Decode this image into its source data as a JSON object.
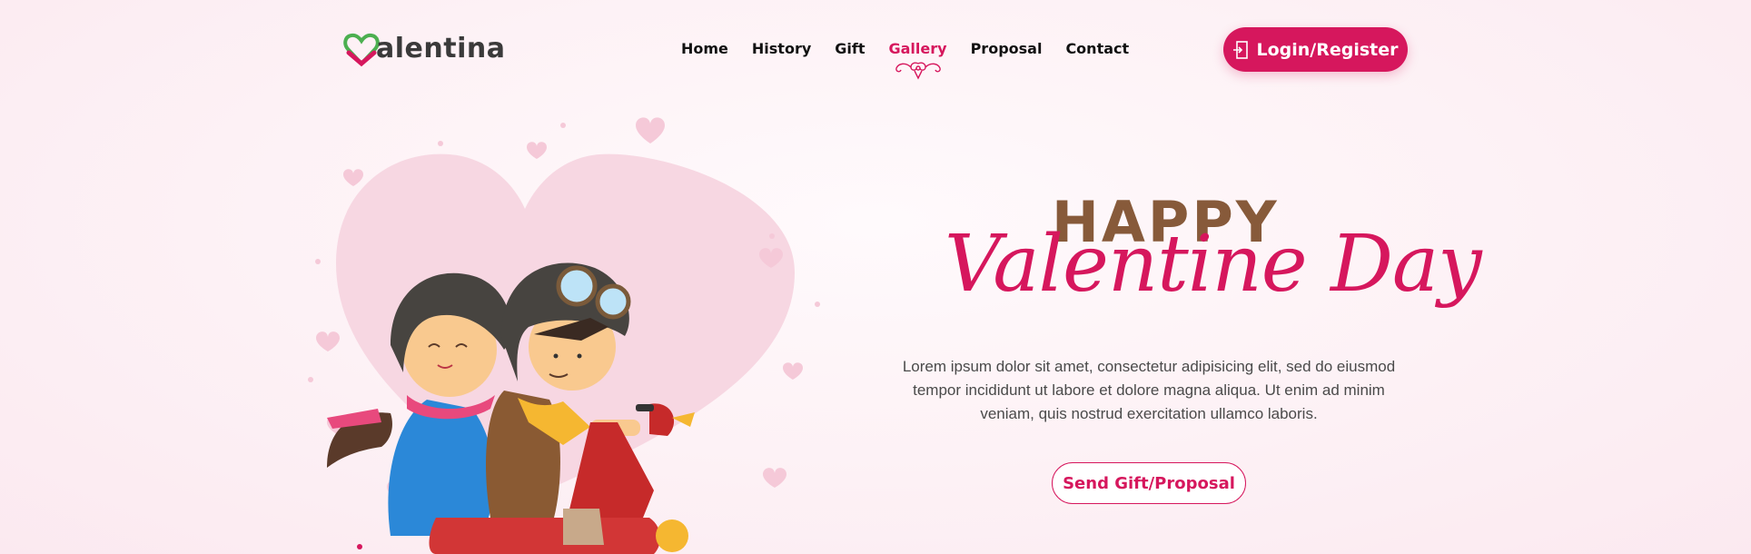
{
  "logo": {
    "text": "alentina",
    "heart_icon": "heart-v-logo-icon"
  },
  "nav": {
    "items": [
      {
        "label": "Home"
      },
      {
        "label": "History"
      },
      {
        "label": "Gift"
      },
      {
        "label": "Gallery",
        "active": true
      },
      {
        "label": "Proposal"
      },
      {
        "label": "Contact"
      }
    ]
  },
  "login": {
    "label": "Login/Register",
    "icon": "door-enter-icon"
  },
  "hero": {
    "title_top": "HAPPY",
    "title_script": "Valentine Day",
    "description": "Lorem ipsum dolor sit amet, consectetur adipisicing elit, sed do eiusmod tempor incididunt ut labore et dolore magna aliqua. Ut enim ad minim veniam, quis nostrud exercitation ullamco laboris.",
    "cta_label": "Send Gift/Proposal"
  },
  "colors": {
    "accent": "#d6175d",
    "title_brown": "#875a3a",
    "heart_bg": "#f7d7e2"
  }
}
